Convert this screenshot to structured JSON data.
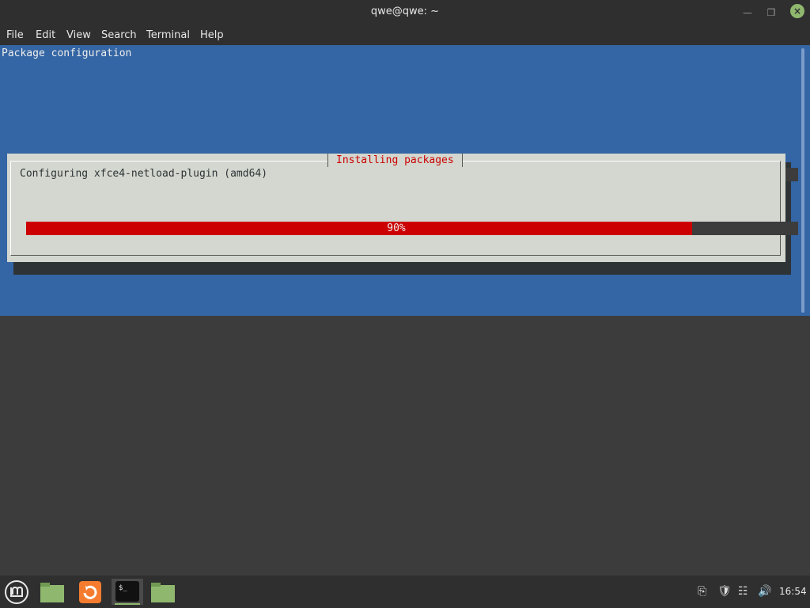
{
  "window": {
    "title": "qwe@qwe: ~",
    "minimize_icon": "minimize-icon",
    "maximize_icon": "maximize-icon",
    "close_icon": "close-icon"
  },
  "menubar": {
    "items": [
      "File",
      "Edit",
      "View",
      "Search",
      "Terminal",
      "Help"
    ]
  },
  "terminal": {
    "heading": "Package configuration",
    "dialog": {
      "title": "Installing packages",
      "message": "Configuring xfce4-netload-plugin (amd64)",
      "progress_label": "90%",
      "progress": 0.9
    }
  },
  "taskbar": {
    "menu_icon": "mint-menu-icon",
    "apps": [
      {
        "icon": "folder-icon",
        "name": "show-desktop"
      },
      {
        "icon": "update-manager-icon",
        "name": "update-manager"
      },
      {
        "icon": "terminal-icon",
        "name": "terminal"
      },
      {
        "icon": "folder-icon",
        "name": "files"
      }
    ],
    "tray_icons": [
      "clipboard-icon",
      "shield-icon",
      "network-icon",
      "volume-icon"
    ],
    "clock": "16:54"
  },
  "colors": {
    "terminal_bg": "#3465a4",
    "dialog_bg": "#d3d7cf",
    "accent_red": "#cc0000",
    "mint_green": "#8fb86e"
  }
}
